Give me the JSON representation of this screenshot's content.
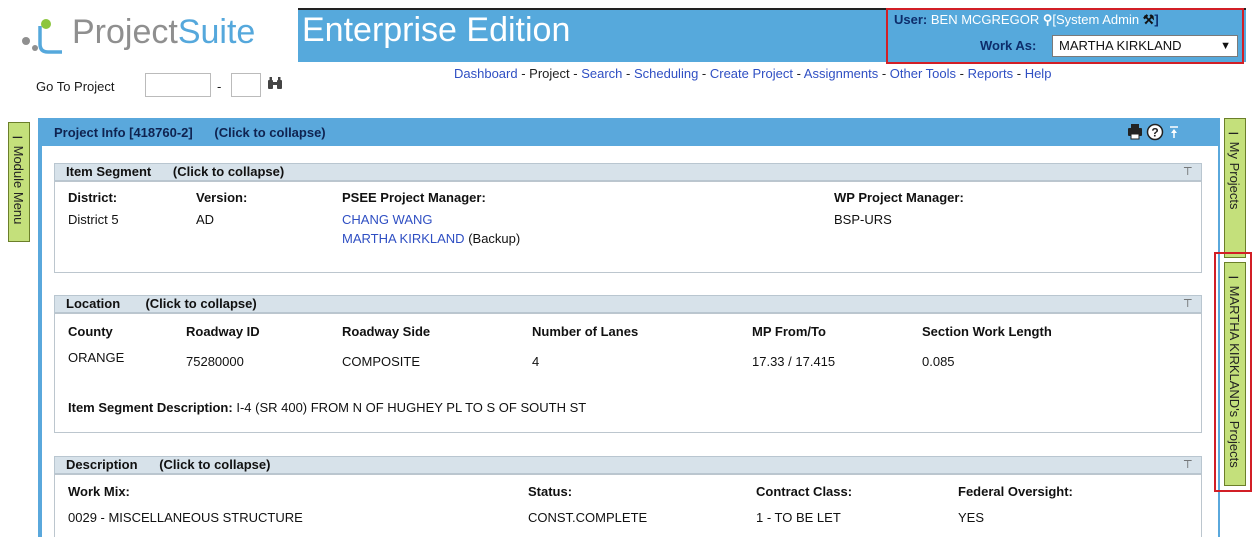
{
  "header": {
    "brand_part1": "Project",
    "brand_part2": "Suite",
    "edition": "Enterprise Edition",
    "user_label": "User:",
    "user_name": "BEN MCGREGOR",
    "user_role": "[System Admin",
    "work_as_label": "Work As:",
    "work_as_value": "MARTHA KIRKLAND"
  },
  "toolbar": {
    "goto_label": "Go To Project",
    "goto_dash": "-",
    "nav": [
      {
        "label": "Dashboard",
        "sep": " - "
      },
      {
        "label": "Project",
        "sep": " - "
      },
      {
        "label": "Search",
        "sep": " - "
      },
      {
        "label": "Scheduling",
        "sep": " - "
      },
      {
        "label": "Create Project",
        "sep": " - "
      },
      {
        "label": "Assignments",
        "sep": " - "
      },
      {
        "label": "Other Tools",
        "sep": " - "
      },
      {
        "label": "Reports",
        "sep": " - "
      },
      {
        "label": "Help",
        "sep": ""
      }
    ]
  },
  "side_tabs": {
    "module_menu": "Module Menu",
    "my_projects": "My Projects",
    "martha_projects": "MARTHA KIRKLAND's Projects"
  },
  "panel": {
    "title": "Project Info [418760-2]",
    "collapse": "(Click to collapse)"
  },
  "item_segment": {
    "title": "Item Segment",
    "collapse": "(Click to collapse)",
    "district_label": "District:",
    "district_value": "District 5",
    "version_label": "Version:",
    "version_value": "AD",
    "psee_label": "PSEE Project Manager:",
    "psee_manager": "CHANG WANG",
    "psee_backup": "MARTHA KIRKLAND",
    "backup_note": "(Backup)",
    "wp_label": "WP Project Manager:",
    "wp_value": "BSP-URS"
  },
  "location": {
    "title": "Location",
    "collapse": "(Click to collapse)",
    "county_label": "County",
    "county_value": "ORANGE",
    "roadway_id_label": "Roadway ID",
    "roadway_id_value": "75280000",
    "roadway_side_label": "Roadway Side",
    "roadway_side_value": "COMPOSITE",
    "lanes_label": "Number of Lanes",
    "lanes_value": "4",
    "mp_label": "MP From/To",
    "mp_value": "17.33 / 17.415",
    "swl_label": "Section Work Length",
    "swl_value": "0.085",
    "desc_label": "Item Segment Description:",
    "desc_value": "I-4 (SR 400) FROM N OF HUGHEY PL TO S OF SOUTH ST"
  },
  "description": {
    "title": "Description",
    "collapse": "(Click to collapse)",
    "workmix_label": "Work Mix:",
    "workmix_value": "0029 - MISCELLANEOUS STRUCTURE",
    "status_label": "Status:",
    "status_value": "CONST.COMPLETE",
    "contract_label": "Contract Class:",
    "contract_value": "1 - TO BE LET",
    "federal_label": "Federal Oversight:",
    "federal_value": "YES"
  },
  "colors": {
    "banner": "#56a9dc",
    "highlight_red": "#d21f26",
    "tab_green": "#c4e07b",
    "link_blue": "#2f4fc3"
  }
}
